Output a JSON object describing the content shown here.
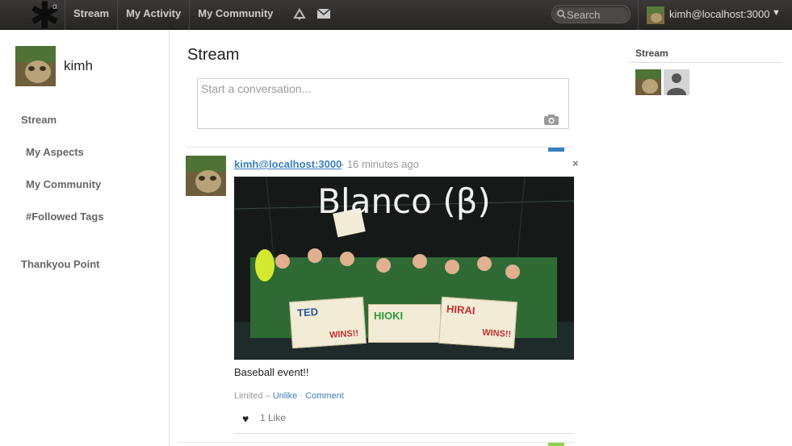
{
  "header": {
    "logo_icon": "diaspora-asterisk-icon",
    "logo_badge": "α",
    "nav": [
      "Stream",
      "My Activity",
      "My Community"
    ],
    "icons": [
      "notifications-icon",
      "mail-icon"
    ],
    "search_placeholder": "Search",
    "user_handle": "kimh@localhost:3000",
    "user_caret": "▼"
  },
  "sidebar": {
    "user_name": "kimh",
    "items": [
      "Stream",
      "My Aspects",
      "My Community",
      "#Followed Tags",
      "Thankyou Point"
    ]
  },
  "main": {
    "title": "Stream",
    "publisher_placeholder": "Start a conversation...",
    "post": {
      "author": "kimh@localhost:3000",
      "time": "- 16 minutes ago",
      "close": "×",
      "image_title": "Blanco (β)",
      "signs": [
        "TED",
        "WINS!!",
        "HIOKI",
        "HIRAI",
        "WINS!!"
      ],
      "text": "Baseball event!!",
      "meta_prefix": "Limited –",
      "unlike": "Unlike",
      "separator": "·",
      "comment": "Comment",
      "heart": "♥",
      "likes": "1 Like"
    }
  },
  "right": {
    "title": "Stream"
  },
  "colors": {
    "link": "#3a7fbd",
    "aspect_marker": "#3a7fbd",
    "next_marker": "#8fd14f"
  }
}
